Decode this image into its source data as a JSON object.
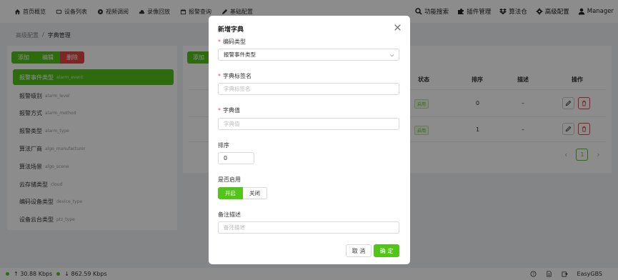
{
  "nav": {
    "left": [
      {
        "label": "首页概览",
        "icon": "home-icon"
      },
      {
        "label": "设备列表",
        "icon": "device-icon"
      },
      {
        "label": "视频调阅",
        "icon": "video-icon"
      },
      {
        "label": "录像回放",
        "icon": "cloud-icon"
      },
      {
        "label": "报警查询",
        "icon": "alarm-icon"
      },
      {
        "label": "基础配置",
        "icon": "edit-icon"
      }
    ],
    "right": [
      {
        "label": "功能搜索",
        "icon": "search-icon"
      },
      {
        "label": "插件管理",
        "icon": "puzzle-icon"
      },
      {
        "label": "算法仓",
        "icon": "dropbox-icon"
      },
      {
        "label": "高级配置",
        "icon": "gear-icon"
      },
      {
        "label": "Manager",
        "icon": "user-icon"
      }
    ]
  },
  "breadcrumb": {
    "parent": "高级配置",
    "separator": "/",
    "current": "字典管理"
  },
  "left_panel": {
    "buttons": {
      "add": "添加",
      "edit": "编辑",
      "delete": "删除"
    },
    "items": [
      {
        "label": "报警事件类型",
        "code": "alarm_event"
      },
      {
        "label": "报警级别",
        "code": "alarm_level"
      },
      {
        "label": "报警方式",
        "code": "alarm_method"
      },
      {
        "label": "报警类型",
        "code": "alarm_type"
      },
      {
        "label": "算法厂商",
        "code": "algo_manufacturer"
      },
      {
        "label": "算法场景",
        "code": "algo_scene"
      },
      {
        "label": "云存储类型",
        "code": "cloud"
      },
      {
        "label": "编码设备类型",
        "code": "device_type"
      },
      {
        "label": "设备云台类型",
        "code": "ptz_type"
      }
    ],
    "active_index": 0
  },
  "right_panel": {
    "add_button": "添加",
    "columns": {
      "status": "状态",
      "sort": "排序",
      "desc": "描述",
      "ops": "操作"
    },
    "rows": [
      {
        "status": "启用",
        "sort": "0",
        "desc": "–"
      },
      {
        "status": "启用",
        "sort": "1",
        "desc": "–"
      }
    ],
    "pagination": {
      "prev": "‹",
      "page": "1",
      "next": "›"
    }
  },
  "dialog": {
    "title": "新增字典",
    "fields": {
      "code_type": {
        "label": "编码类型",
        "value": "报警事件类型"
      },
      "dict_label": {
        "label": "字典标签名",
        "placeholder": "字典标签名"
      },
      "dict_value": {
        "label": "字典值",
        "placeholder": "字典值"
      },
      "sort": {
        "label": "排序",
        "value": "0"
      },
      "enabled": {
        "label": "是否启用",
        "on": "开启",
        "off": "关闭"
      },
      "remark": {
        "label": "备注描述",
        "placeholder": "备注描述"
      }
    },
    "cancel": "取 消",
    "confirm": "确 定"
  },
  "footer": {
    "upload": "↑ 30.88 Kbps",
    "download": "↓ 862.59 Kbps",
    "brand": "EasyGBS"
  },
  "colors": {
    "accent": "#52c41a",
    "danger": "#e54545"
  }
}
